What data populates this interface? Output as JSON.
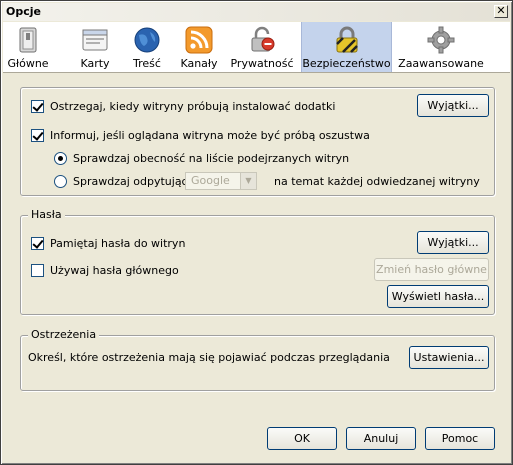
{
  "window": {
    "title": "Opcje",
    "close_glyph": "✕"
  },
  "tabs": [
    {
      "label": "Główne",
      "icon": "switch-icon"
    },
    {
      "label": "Karty",
      "icon": "tabs-window-icon"
    },
    {
      "label": "Treść",
      "icon": "globe-icon"
    },
    {
      "label": "Kanały",
      "icon": "rss-feed-icon"
    },
    {
      "label": "Prywatność",
      "icon": "privacy-mask-icon"
    },
    {
      "label": "Bezpieczeństwo",
      "icon": "padlock-icon"
    },
    {
      "label": "Zaawansowane",
      "icon": "gear-icon"
    }
  ],
  "selected_tab": "Bezpieczeństwo",
  "general": {
    "warn_addons": {
      "label": "Ostrzegaj, kiedy witryny próbują instalować dodatki",
      "checked": true
    },
    "exceptions_label": "Wyjątki...",
    "phishing": {
      "label": "Informuj, jeśli oglądana witryna może być próbą oszustwa",
      "checked": true
    },
    "radio_list": {
      "label": "Sprawdzaj obecność na liście podejrzanych witryn",
      "checked": true
    },
    "radio_query": {
      "label_before": "Sprawdzaj odpytując",
      "label_after": "na temat każdej odwiedzanej witryny",
      "checked": false
    },
    "provider_select": {
      "value": "Google",
      "enabled": false
    }
  },
  "passwords": {
    "legend": "Hasła",
    "remember": {
      "label": "Pamiętaj hasła do witryn",
      "checked": true
    },
    "exceptions_label": "Wyjątki...",
    "master": {
      "label": "Używaj hasła głównego",
      "checked": false
    },
    "change_master_label": "Zmień hasło główne",
    "show_passwords_label": "Wyświetl hasła..."
  },
  "warnings": {
    "legend": "Ostrzeżenia",
    "description": "Określ, które ostrzeżenia mają się pojawiać podczas przeglądania",
    "settings_label": "Ustawienia..."
  },
  "footer": {
    "ok": "OK",
    "cancel": "Anuluj",
    "help": "Pomoc"
  },
  "colors": {
    "selected_tab": "#c4d3ec",
    "dialog_bg": "#ece9d8",
    "button_border": "#003c74"
  }
}
